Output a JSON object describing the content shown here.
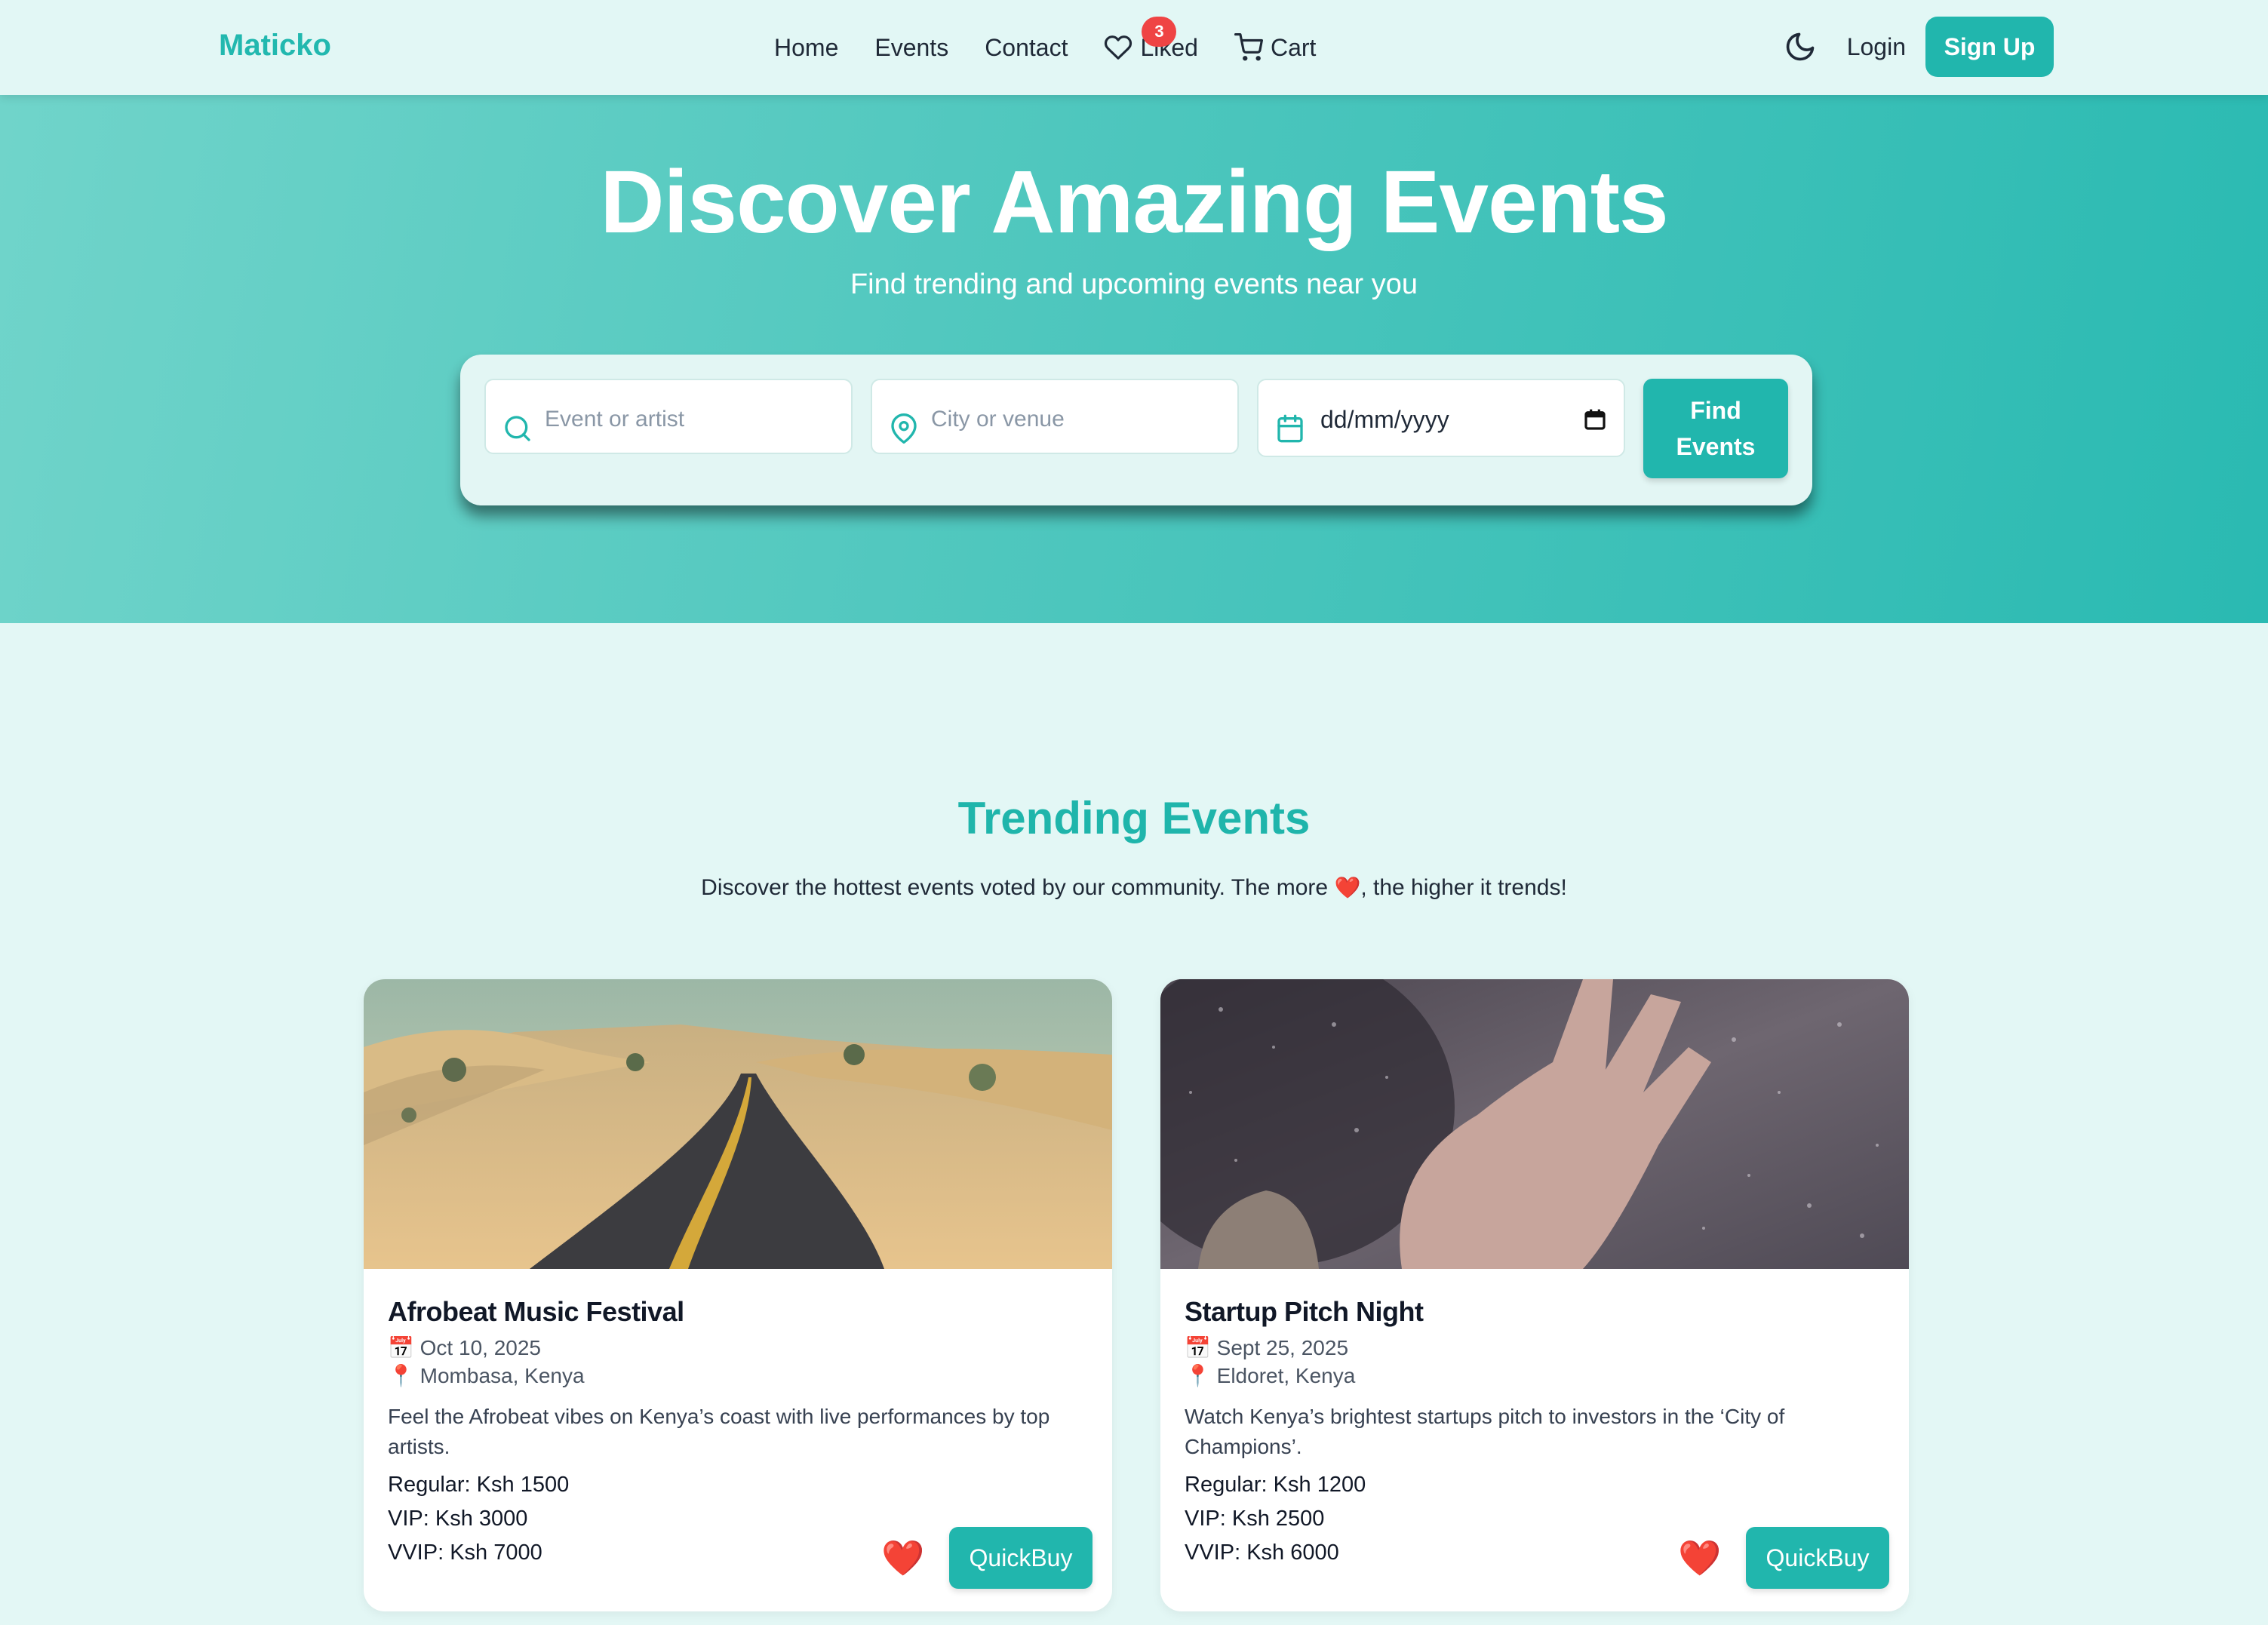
{
  "nav": {
    "brand": "Maticko",
    "links": {
      "home": "Home",
      "events": "Events",
      "contact": "Contact",
      "liked": "Liked",
      "cart": "Cart"
    },
    "liked_count": "3",
    "login": "Login",
    "signup": "Sign Up",
    "icons": [
      "heart-icon",
      "cart-icon",
      "moon-icon"
    ]
  },
  "hero": {
    "title": "Discover Amazing Events",
    "subtitle": "Find trending and upcoming events near you"
  },
  "search": {
    "event_placeholder": "Event or artist",
    "city_placeholder": "City or venue",
    "date_value": "dd/mm/yyyy",
    "button": "Find\nEvents"
  },
  "trending": {
    "title": "Trending Events",
    "subtitle_before": "Discover the hottest events voted by our community. The more ",
    "subtitle_after": ", the higher it trends!"
  },
  "events": [
    {
      "title": "Afrobeat Music Festival",
      "date_icon": "📅",
      "date": "Oct 10, 2025",
      "location_icon": "📍",
      "location": "Mombasa, Kenya",
      "description": "Feel the Afrobeat vibes on Kenya’s coast with live performances by top artists.",
      "prices": [
        "Regular: Ksh 1500",
        "VIP: Ksh 3000",
        "VVIP: Ksh 7000"
      ],
      "button": "QuickBuy"
    },
    {
      "title": "Startup Pitch Night",
      "date_icon": "📅",
      "date": "Sept 25, 2025",
      "location_icon": "📍",
      "location": "Eldoret, Kenya",
      "description": "Watch Kenya’s brightest startups pitch to investors in the ‘City of Champions’.",
      "prices": [
        "Regular: Ksh 1200",
        "VIP: Ksh 2500",
        "VVIP: Ksh 6000"
      ],
      "button": "QuickBuy"
    }
  ],
  "colors": {
    "accent": "#21b6ad",
    "page_bg": "#e3f7f5",
    "badge": "#ef4444",
    "heart": "#e11d2e"
  }
}
